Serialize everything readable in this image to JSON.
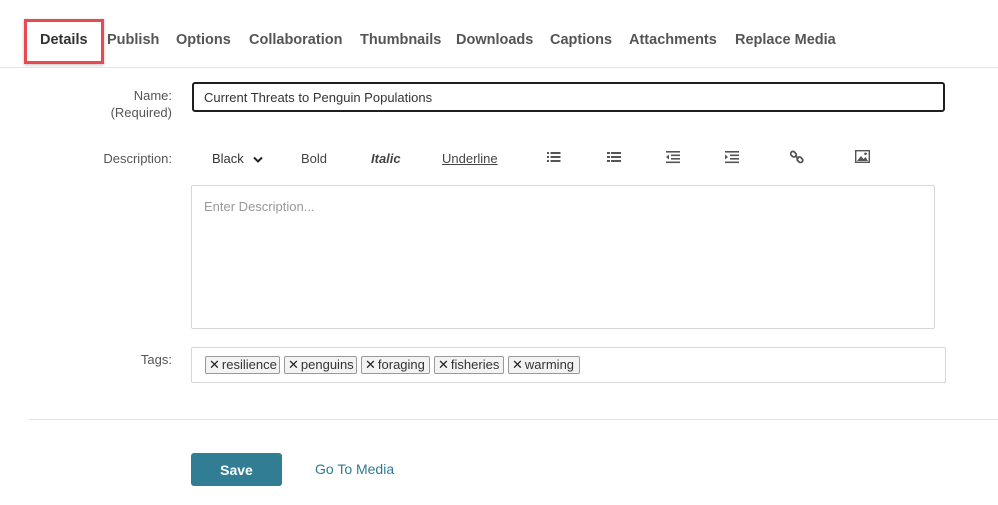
{
  "tabs": [
    {
      "label": "Details"
    },
    {
      "label": "Publish"
    },
    {
      "label": "Options"
    },
    {
      "label": "Collaboration"
    },
    {
      "label": "Thumbnails"
    },
    {
      "label": "Downloads"
    },
    {
      "label": "Captions"
    },
    {
      "label": "Attachments"
    },
    {
      "label": "Replace Media"
    }
  ],
  "active_tab": "Details",
  "form": {
    "name_label": "Name:",
    "name_required": "(Required)",
    "name_value": "Current Threats to Penguin Populations",
    "description_label": "Description:",
    "description_placeholder": "Enter Description...",
    "tags_label": "Tags:"
  },
  "toolbar": {
    "color_select": "Black",
    "bold": "Bold",
    "italic": "Italic",
    "underline": "Underline",
    "icons": [
      "unordered-list-icon",
      "ordered-list-icon",
      "outdent-icon",
      "indent-icon",
      "link-icon",
      "image-icon"
    ]
  },
  "tags": [
    {
      "label": "resilience"
    },
    {
      "label": "penguins"
    },
    {
      "label": "foraging"
    },
    {
      "label": "fisheries"
    },
    {
      "label": "warming"
    }
  ],
  "actions": {
    "save": "Save",
    "go_to_media": "Go To Media"
  },
  "colors": {
    "accent": "#317d94",
    "link": "#2d7a93",
    "highlight": "#e8494f"
  }
}
